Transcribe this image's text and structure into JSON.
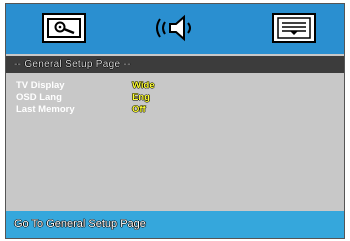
{
  "tabs": [
    {
      "icon": "general-setup-icon"
    },
    {
      "icon": "audio-setup-icon"
    },
    {
      "icon": "preference-setup-icon"
    }
  ],
  "page_header": {
    "title": "-- General Setup Page --"
  },
  "settings": [
    {
      "label": "TV Display",
      "value": "Wide"
    },
    {
      "label": "OSD Lang",
      "value": "Eng"
    },
    {
      "label": "Last Memory",
      "value": "Off"
    }
  ],
  "status_bar": {
    "text": "Go To General Setup Page"
  },
  "colors": {
    "top_bar": "#2a8fd0",
    "header_bar": "#3c3c3c",
    "panel_bg": "#c8c8c8",
    "value_text": "#ffff33",
    "status_bar": "#35a7dc"
  }
}
